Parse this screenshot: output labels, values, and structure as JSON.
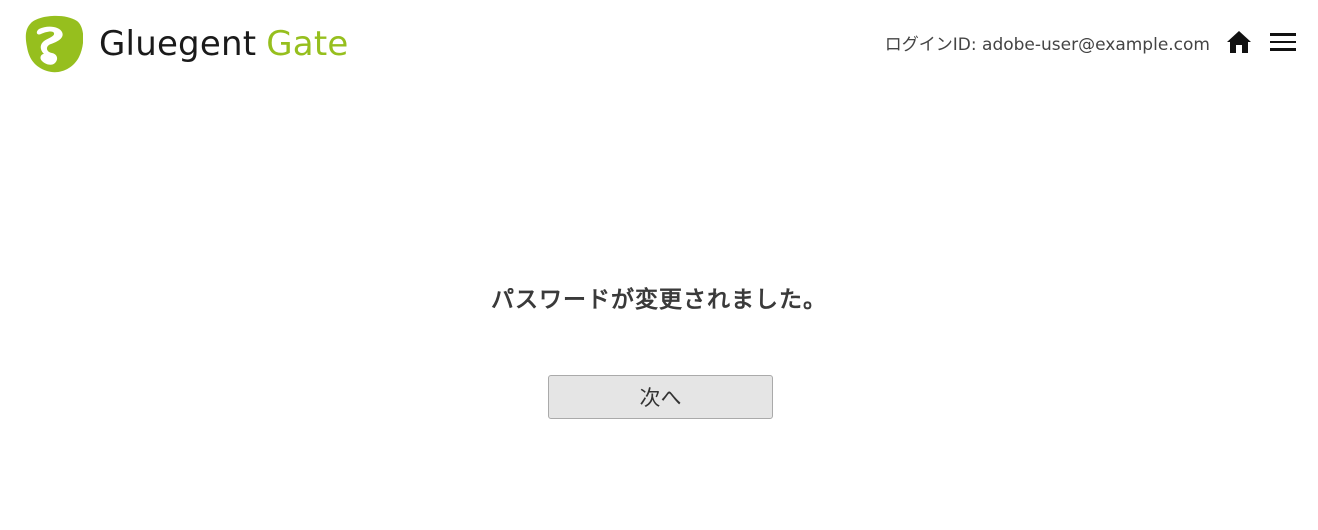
{
  "header": {
    "logo": {
      "word1": "Gluegent",
      "word2": "Gate",
      "brand_color": "#96bf1e",
      "icon": "gluegent-logo-icon"
    },
    "login_id": "ログインID: adobe-user@example.com",
    "home_icon": "home-icon",
    "menu_icon": "hamburger-menu-icon"
  },
  "main": {
    "message": "パスワードが変更されました。",
    "next_button_label": "次へ"
  }
}
